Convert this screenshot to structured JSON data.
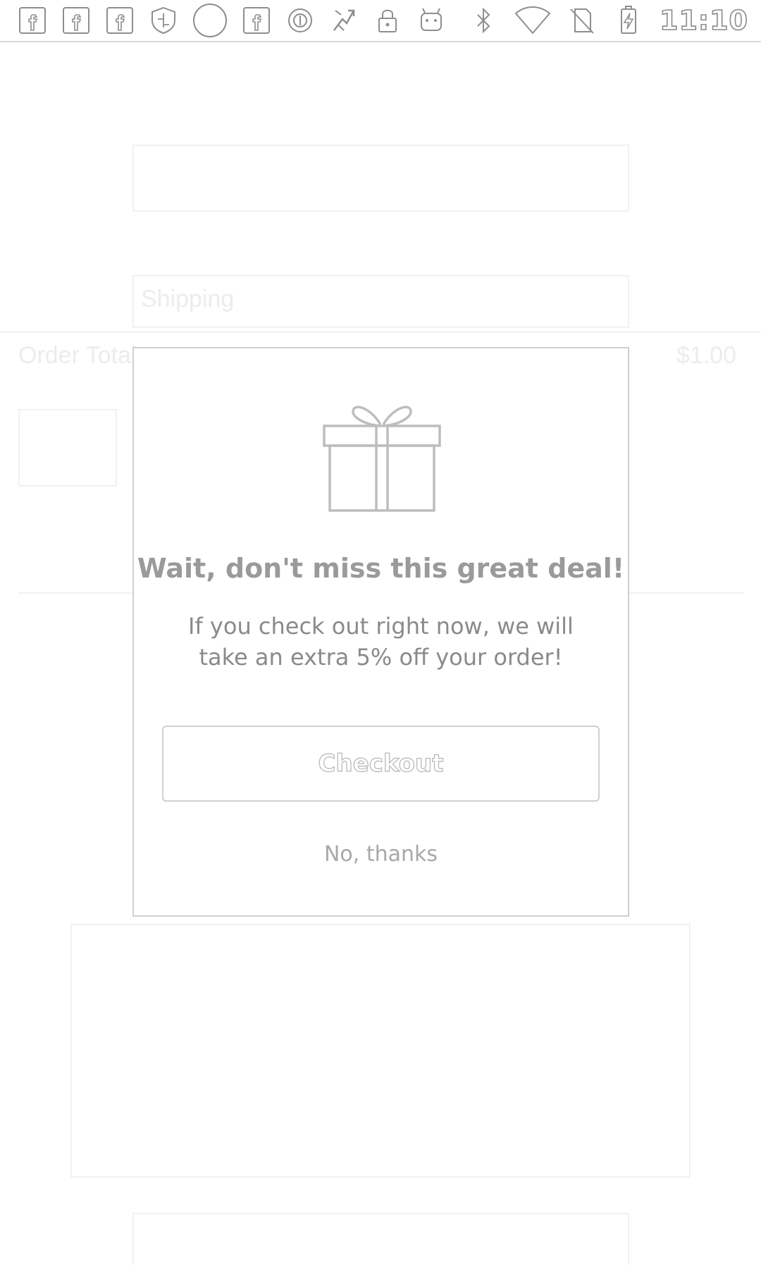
{
  "status_bar": {
    "left_icons": [
      "facebook-icon",
      "facebook-icon",
      "facebook-icon",
      "shield-icon",
      "circle-icon",
      "facebook-icon",
      "target-icon",
      "signal-boost-icon",
      "lock-icon",
      "android-icon"
    ],
    "right_icons": [
      "bluetooth-icon",
      "wifi-icon",
      "no-sim-icon",
      "battery-charging-icon"
    ],
    "time": "11:10"
  },
  "background": {
    "ghost_labels": [
      "Shipping",
      "Order Total",
      "$1.00"
    ]
  },
  "modal": {
    "icon": "gift-icon",
    "title": "Wait, don't miss this great deal!",
    "body": "If you check out right now, we will take an extra 5% off your order!",
    "checkout_label": "Checkout",
    "dismiss_label": "No, thanks"
  },
  "colors": {
    "outline": "#cfcfcf",
    "title_text": "#9a9a9a",
    "body_text": "#8a8a8a",
    "muted_text": "#a8a8a8"
  }
}
